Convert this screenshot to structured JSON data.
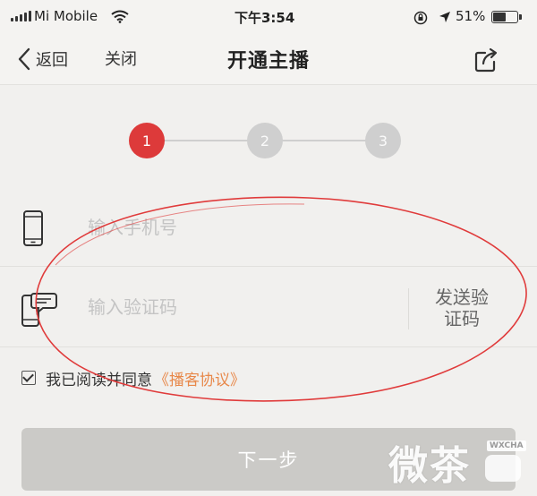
{
  "status_bar": {
    "carrier": "Mi Mobile",
    "time": "下午3:54",
    "battery": "51%",
    "battery_level": 0.51,
    "icons": [
      "signal-icon",
      "wifi-icon",
      "orientation-lock-icon",
      "location-icon",
      "battery-icon"
    ]
  },
  "nav": {
    "back_label": "返回",
    "close_label": "关闭",
    "title": "开通主播",
    "icons": [
      "back-chevron-icon",
      "share-icon"
    ]
  },
  "stepper": {
    "steps": [
      "1",
      "2",
      "3"
    ],
    "current_step": 1,
    "active_color": "#dd3a3a",
    "inactive_color": "#cfcfcf"
  },
  "form": {
    "phone_placeholder": "输入手机号",
    "phone_value": "",
    "code_placeholder": "输入验证码",
    "code_value": "",
    "send_code_line1": "发送验",
    "send_code_line2": "证码",
    "icons": [
      "phone-icon",
      "sms-code-icon"
    ]
  },
  "agreement": {
    "checked": true,
    "text": "我已阅读并同意",
    "link": "《播客协议》",
    "link_color": "#e8884a"
  },
  "next_button": {
    "label": "下一步"
  },
  "annotation": {
    "type": "red-ellipse",
    "color": "#e03b3b"
  },
  "watermark": {
    "logo": "微茶",
    "tag": "WXCHA"
  }
}
